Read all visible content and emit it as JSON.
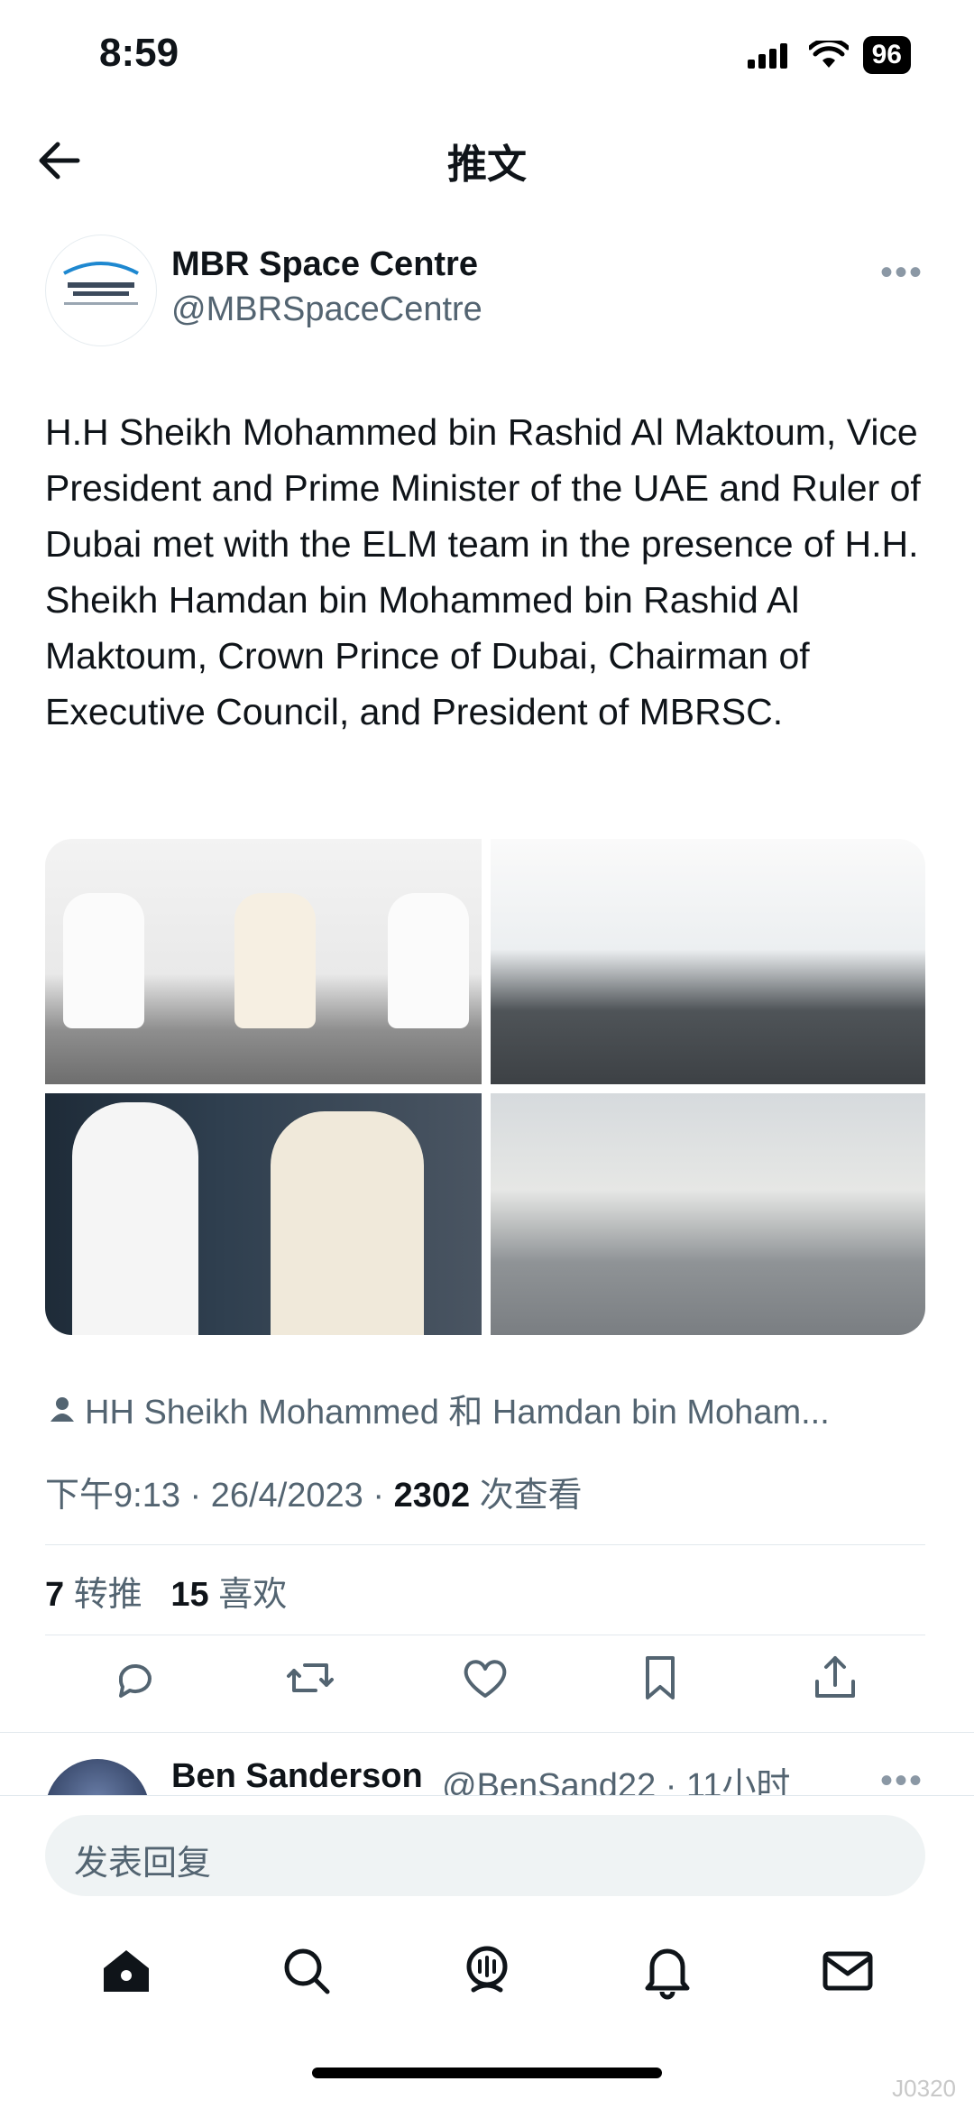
{
  "status_bar": {
    "time": "8:59",
    "battery": "96"
  },
  "header": {
    "title": "推文"
  },
  "author": {
    "name": "MBR Space Centre",
    "handle": "@MBRSpaceCentre",
    "more": "•••"
  },
  "tweet": {
    "text": "H.H Sheikh Mohammed bin Rashid Al Maktoum, Vice President and Prime Minister of the UAE and Ruler of Dubai met with the ELM team in the presence of H.H. Sheikh Hamdan bin Mohammed bin Rashid Al Maktoum, Crown Prince of Dubai, Chairman of Executive Council, and President of MBRSC."
  },
  "tagged": "HH Sheikh Mohammed 和 Hamdan bin Moham...",
  "meta": {
    "time": "下午9:13 · 26/4/2023 · ",
    "views": "2302",
    "views_label": " 次查看"
  },
  "stats": {
    "retweets": "7",
    "retweets_label": "转推",
    "likes": "15",
    "likes_label": "喜欢"
  },
  "reply": {
    "name": "Ben Sanderson",
    "handle": "@BenSand22 · 11小时",
    "more": "•••"
  },
  "composer": {
    "placeholder": "发表回复"
  },
  "watermark": "J0320"
}
